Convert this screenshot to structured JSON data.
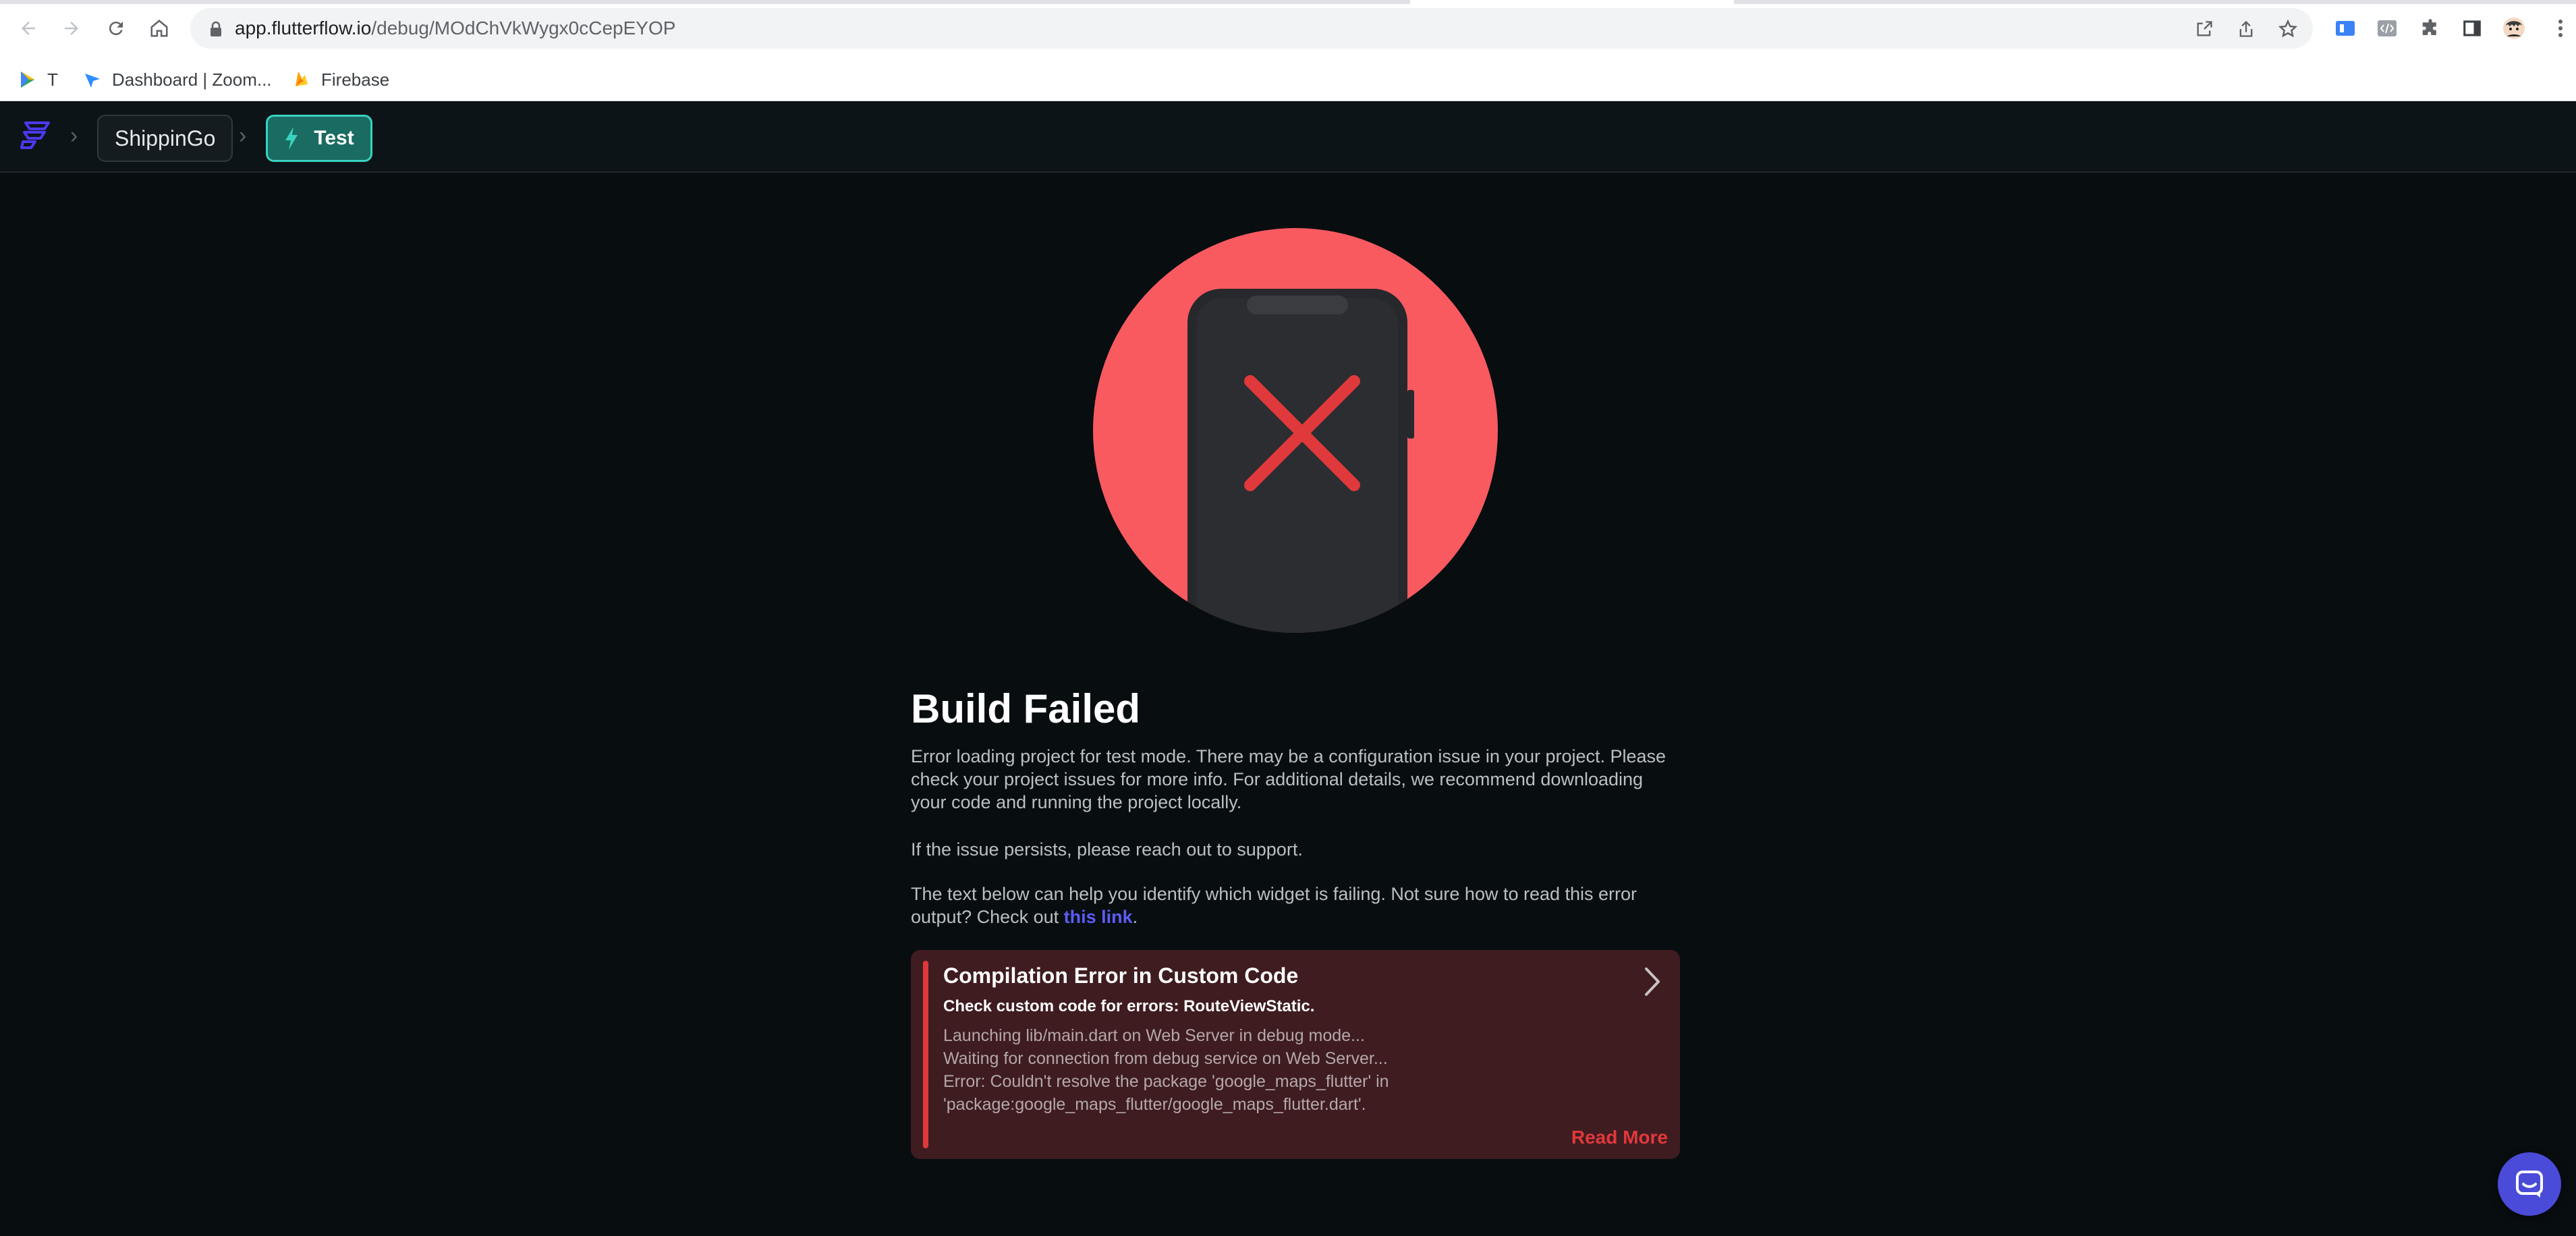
{
  "browser": {
    "url_host": "app.flutterflow.io",
    "url_path": "/debug/MOdChVkWygx0cCepEYOP",
    "bookmarks": [
      {
        "label": "T",
        "icon": "play-console-icon"
      },
      {
        "label": "Dashboard | Zoom...",
        "icon": "zoom-icon"
      },
      {
        "label": "Firebase",
        "icon": "firebase-icon"
      }
    ]
  },
  "app_header": {
    "project_name": "ShippinGo",
    "mode_label": "Test",
    "logo": "flutterflow-logo"
  },
  "main": {
    "title": "Build Failed",
    "paragraph_1": "Error loading project for test mode. There may be a configuration issue in your project. Please check your project issues for more info. For additional details, we recommend downloading your code and running the project locally.",
    "paragraph_2": "If the issue persists, please reach out to support.",
    "paragraph_3_prefix": "The text below can help you identify which widget is failing. Not sure how to read this error output? Check out ",
    "paragraph_3_link": "this link",
    "paragraph_3_suffix": "."
  },
  "error_card": {
    "title": "Compilation Error in Custom Code",
    "subtitle": "Check custom code for errors: RouteViewStatic.",
    "log_lines": [
      "Launching lib/main.dart on Web Server in debug mode...",
      "Waiting for connection from debug service on Web Server...",
      "Error: Couldn't resolve the package 'google_maps_flutter' in",
      "'package:google_maps_flutter/google_maps_flutter.dart'."
    ],
    "read_more": "Read More"
  },
  "colors": {
    "background": "#080d10",
    "accent_teal": "#39d2c0",
    "error_red": "#e0393c",
    "hero_circle": "#f85a60",
    "link": "#5b5cf5"
  }
}
